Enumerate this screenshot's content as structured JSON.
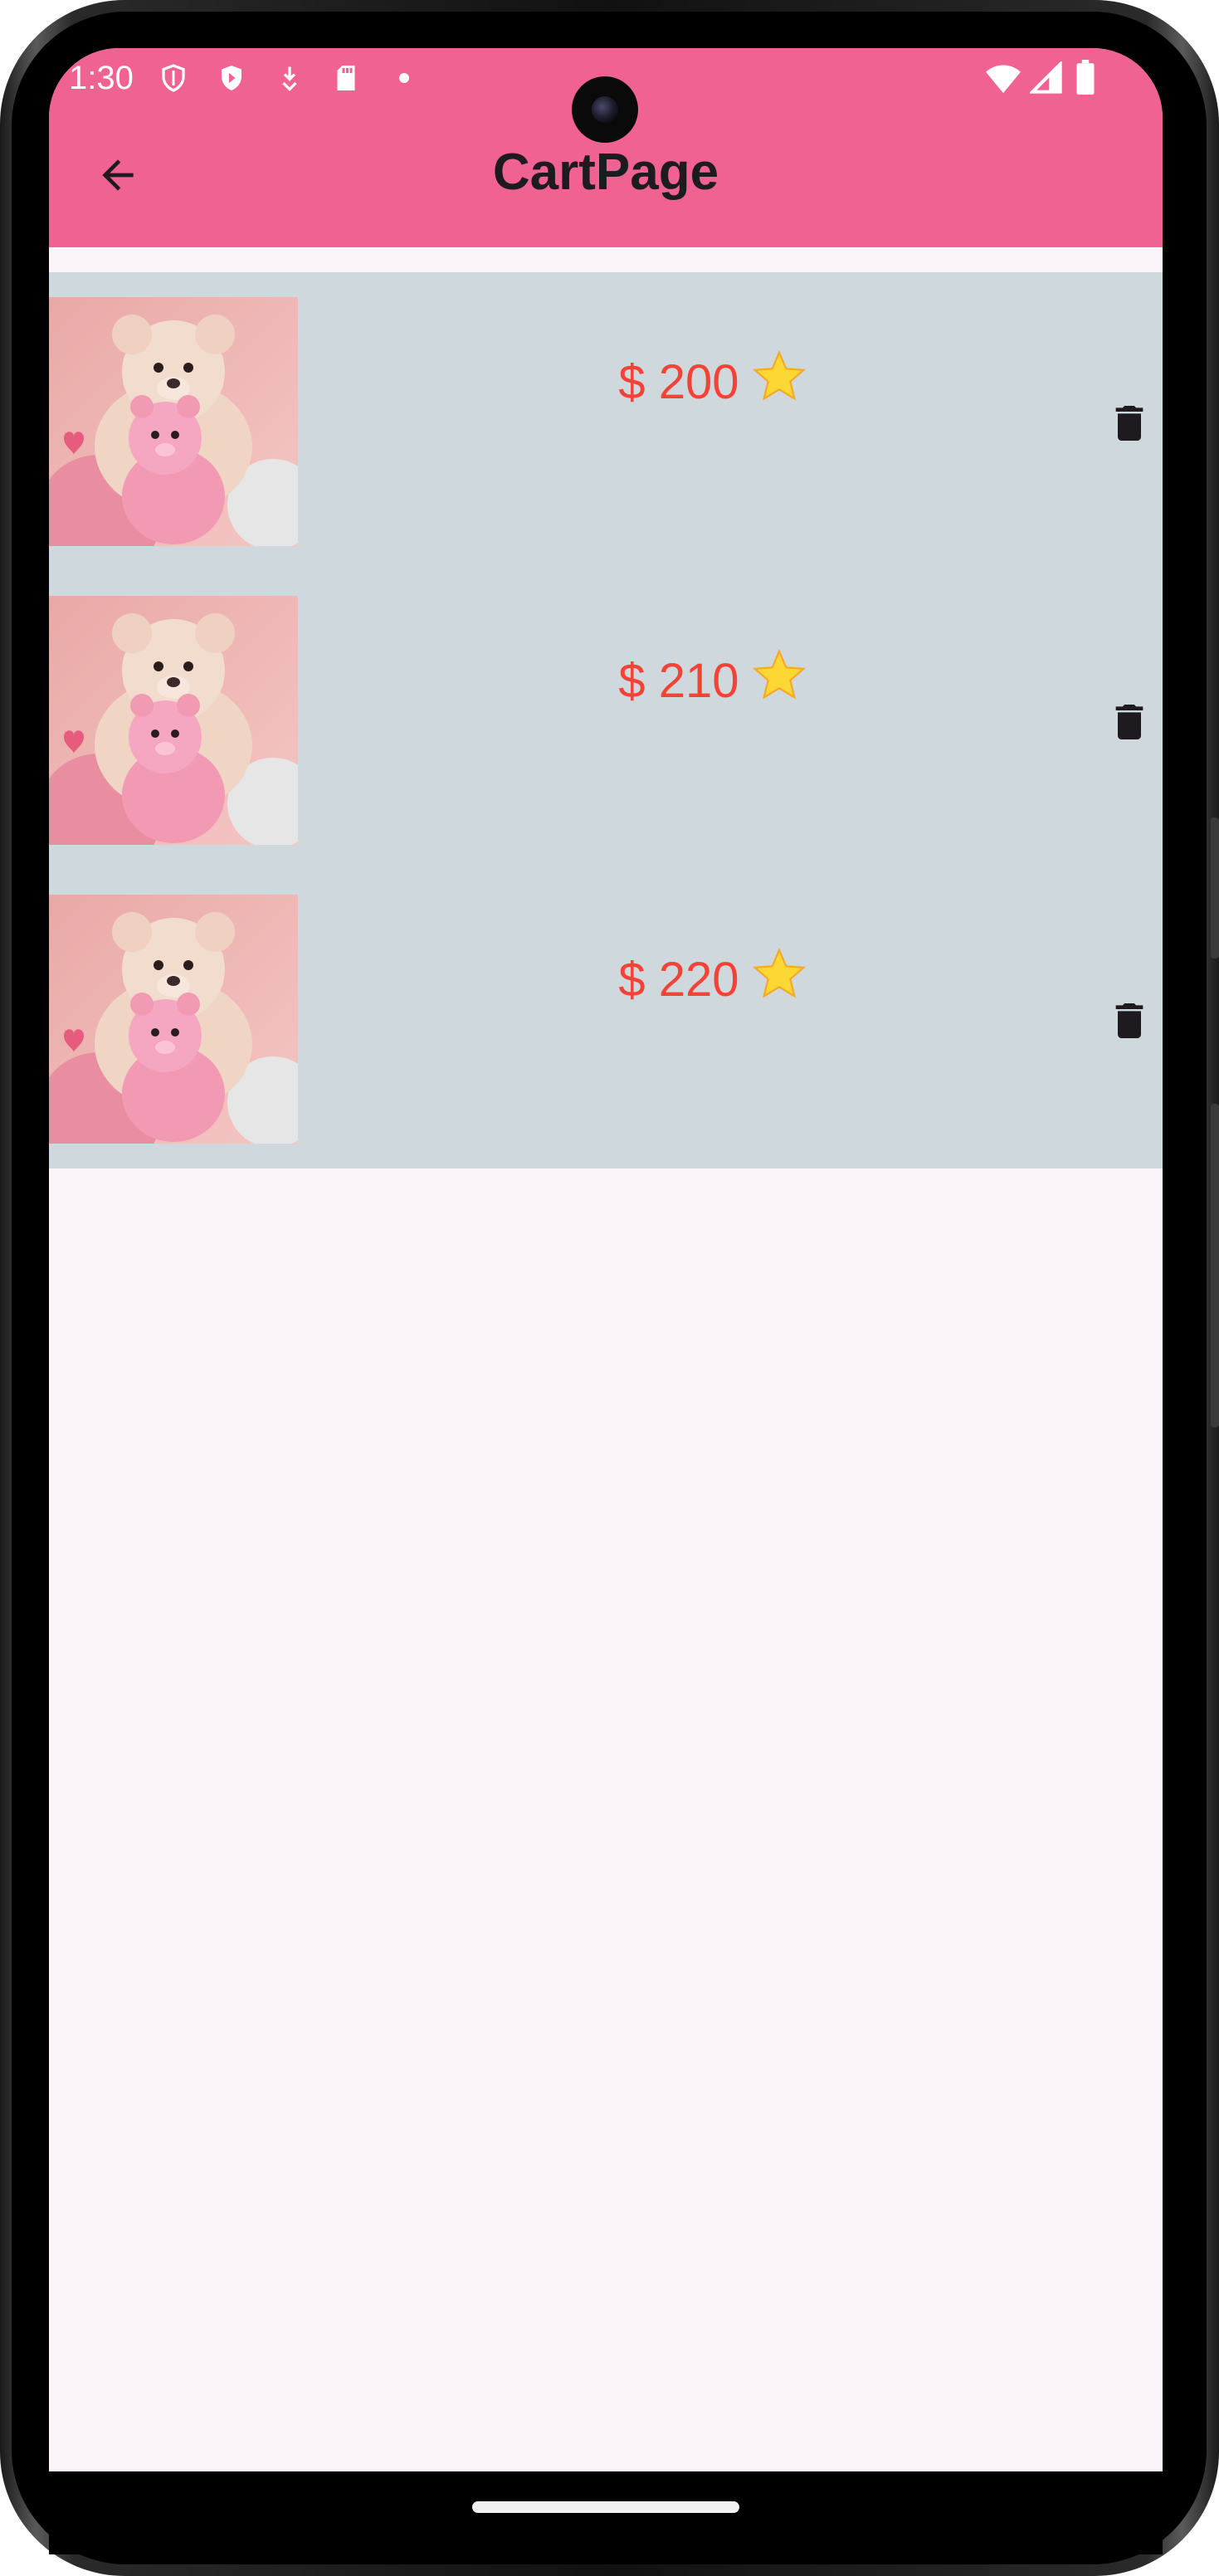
{
  "status_bar": {
    "time": "1:30",
    "left_icons": [
      "shield-outline-icon",
      "shield-play-icon",
      "download-icon",
      "sd-card-icon",
      "dot-icon"
    ],
    "right_icons": [
      "wifi-icon",
      "signal-icon",
      "battery-icon"
    ]
  },
  "app_bar": {
    "title": "CartPage",
    "back_icon": "arrow-back-icon",
    "color": "#f06292"
  },
  "cart": {
    "items": [
      {
        "price": "$ 200",
        "rating_icon": "star-icon",
        "image": "teddy-bears-photo",
        "delete_icon": "trash-icon"
      },
      {
        "price": "$ 210",
        "rating_icon": "star-icon",
        "image": "teddy-bears-photo",
        "delete_icon": "trash-icon"
      },
      {
        "price": "$ 220",
        "rating_icon": "star-icon",
        "image": "teddy-bears-photo",
        "delete_icon": "trash-icon"
      }
    ],
    "background": "#cfd8dc",
    "price_color": "#f44336"
  },
  "screen_background": "#fbf4fb"
}
